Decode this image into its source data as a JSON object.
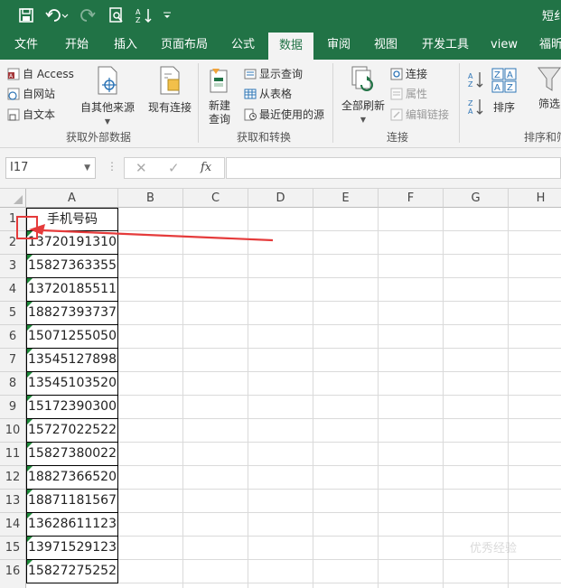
{
  "titlebar": {
    "title": "短纟",
    "save_icon": "save-icon",
    "undo_icon": "undo-icon",
    "redo_icon": "redo-icon",
    "print_preview_icon": "print-preview-icon",
    "sort_icon": "sort-icon",
    "customize_icon": "customize-qat-icon"
  },
  "tabs": [
    {
      "label": "文件"
    },
    {
      "label": "开始"
    },
    {
      "label": "插入"
    },
    {
      "label": "页面布局"
    },
    {
      "label": "公式"
    },
    {
      "label": "数据",
      "active": true
    },
    {
      "label": "审阅"
    },
    {
      "label": "视图"
    },
    {
      "label": "开发工具"
    },
    {
      "label": "view"
    },
    {
      "label": "福昕"
    }
  ],
  "ribbon": {
    "get_external": {
      "access": "自 Access",
      "web": "自网站",
      "text": "自文本",
      "other": "自其他来源",
      "existing": "现有连接",
      "label": "获取外部数据"
    },
    "get_transform": {
      "new_query": "新建",
      "new_query2": "查询",
      "show_queries": "显示查询",
      "from_table": "从表格",
      "recent_sources": "最近使用的源",
      "label": "获取和转换"
    },
    "connections": {
      "refresh_all": "全部刷新",
      "connections": "连接",
      "properties": "属性",
      "edit_links": "编辑链接",
      "label": "连接"
    },
    "sort_filter": {
      "sort": "排序",
      "filter": "筛选",
      "label": "排序和筛"
    }
  },
  "formula_bar": {
    "name_box": "I17",
    "cancel": "✕",
    "enter": "✓",
    "fx": "fx",
    "content": ""
  },
  "columns": [
    "A",
    "B",
    "C",
    "D",
    "E",
    "F",
    "G",
    "H"
  ],
  "rows": [
    "1",
    "2",
    "3",
    "4",
    "5",
    "6",
    "7",
    "8",
    "9",
    "10",
    "11",
    "12",
    "13",
    "14",
    "15",
    "16"
  ],
  "cells": [
    "手机号码",
    "13720191310",
    "15827363355",
    "13720185511",
    "18827393737",
    "15071255050",
    "13545127898",
    "13545103520",
    "15172390300",
    "15727022522",
    "15827380022",
    "18827366520",
    "18871181567",
    "13628611123",
    "13971529123",
    "15827275252"
  ],
  "colors": {
    "excel_green": "#217346",
    "annotation_red": "#e53b3b",
    "error_triangle": "#1f8a3b"
  },
  "watermark": "优秀经验"
}
